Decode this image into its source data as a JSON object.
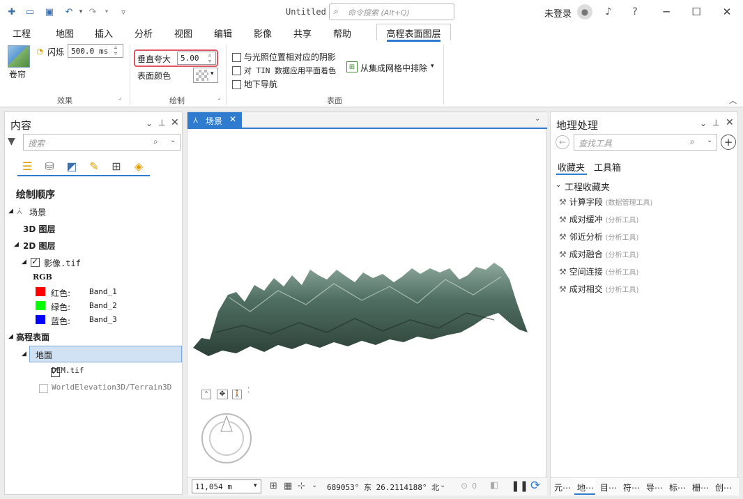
{
  "window": {
    "title": "Untitled",
    "search_placeholder": "命令搜索 (Alt+Q)",
    "signin": "未登录"
  },
  "tabs": [
    "工程",
    "地图",
    "插入",
    "分析",
    "视图",
    "编辑",
    "影像",
    "共享",
    "帮助"
  ],
  "active_tab": "高程表面图层",
  "ribbon": {
    "swipe_label": "卷帘",
    "flash_label": "闪烁",
    "flash_value": "500.0",
    "flash_unit": "ms",
    "effects_group": "效果",
    "exaggeration_label": "垂直夸大",
    "exaggeration_value": "5.00",
    "surface_color_label": "表面颜色",
    "draw_group": "绘制",
    "opt_shadow": "与光照位置相对应的阴影",
    "opt_tin": "对 TIN 数据应用平面着色",
    "opt_underground": "地下导航",
    "exclude_label": "从集成网格中排除",
    "surface_group": "表面"
  },
  "contents": {
    "title": "内容",
    "search_placeholder": "搜索",
    "draw_order": "绘制顺序",
    "scene": "场景",
    "layers3d": "3D 图层",
    "layers2d": "2D 图层",
    "imagery": "影像.tif",
    "rgb": "RGB",
    "bands": [
      {
        "name": "红色:",
        "band": "Band_1",
        "color": "#ff0000"
      },
      {
        "name": "绿色:",
        "band": "Band_2",
        "color": "#00ff00"
      },
      {
        "name": "蓝色:",
        "band": "Band_3",
        "color": "#0000ff"
      }
    ],
    "elevation": "高程表面",
    "ground": "地面",
    "dem": "DEM.tif",
    "world": "WorldElevation3D/Terrain3D"
  },
  "view": {
    "tab": "场景",
    "scale": "11,054 m",
    "coords": "689053° 东  26.2114188° 北",
    "sel_count": "0"
  },
  "geoprocessing": {
    "title": "地理处理",
    "search_placeholder": "查找工具",
    "tab_fav": "收藏夹",
    "tab_toolbox": "工具箱",
    "section": "工程收藏夹",
    "tools": [
      {
        "name": "计算字段",
        "sub": "(数据管理工具)"
      },
      {
        "name": "成对缓冲",
        "sub": "(分析工具)"
      },
      {
        "name": "邻近分析",
        "sub": "(分析工具)"
      },
      {
        "name": "成对融合",
        "sub": "(分析工具)"
      },
      {
        "name": "空间连接",
        "sub": "(分析工具)"
      },
      {
        "name": "成对相交",
        "sub": "(分析工具)"
      }
    ],
    "bottom_tabs": [
      "元⋯",
      "地⋯",
      "目⋯",
      "符⋯",
      "导⋯",
      "标⋯",
      "栅⋯",
      "创⋯"
    ]
  }
}
